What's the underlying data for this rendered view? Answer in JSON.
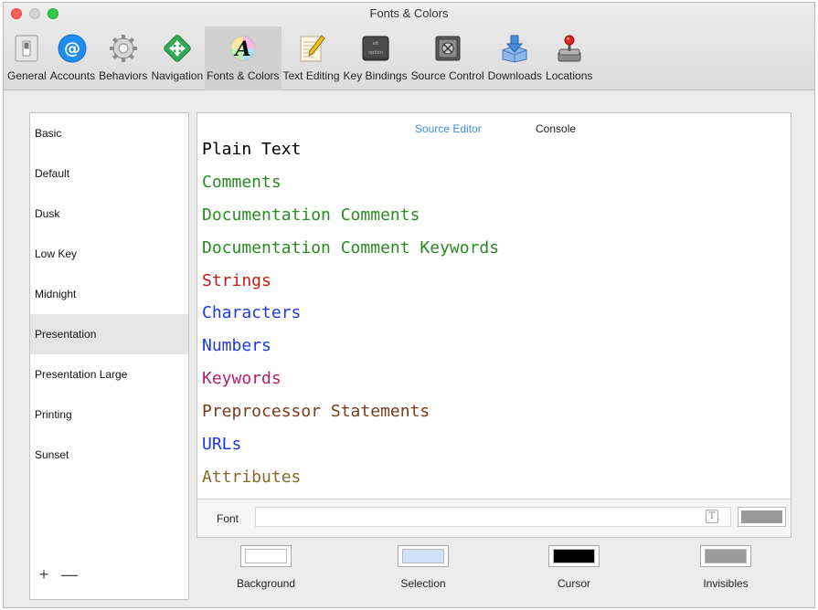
{
  "window": {
    "title": "Fonts & Colors"
  },
  "toolbar": {
    "items": [
      {
        "label": "General",
        "icon": "switch-icon"
      },
      {
        "label": "Accounts",
        "icon": "at-sign-icon"
      },
      {
        "label": "Behaviors",
        "icon": "gear-icon"
      },
      {
        "label": "Navigation",
        "icon": "navigation-arrows-icon"
      },
      {
        "label": "Fonts & Colors",
        "icon": "font-palette-icon",
        "selected": true
      },
      {
        "label": "Text Editing",
        "icon": "notepad-pencil-icon"
      },
      {
        "label": "Key Bindings",
        "icon": "option-key-icon",
        "key_text": "alt\noption"
      },
      {
        "label": "Source Control",
        "icon": "vault-icon"
      },
      {
        "label": "Downloads",
        "icon": "download-box-icon"
      },
      {
        "label": "Locations",
        "icon": "joystick-icon"
      }
    ]
  },
  "themes": {
    "items": [
      "Basic",
      "Default",
      "Dusk",
      "Low Key",
      "Midnight",
      "Presentation",
      "Presentation Large",
      "Printing",
      "Sunset"
    ],
    "selected": "Presentation",
    "add_label": "+",
    "remove_label": "—"
  },
  "editor": {
    "tabs": {
      "source_editor": "Source Editor",
      "console": "Console"
    },
    "active_tab": "Source Editor",
    "syntax_items": [
      {
        "label": "Plain Text",
        "color": "#000000"
      },
      {
        "label": "Comments",
        "color": "#2a8a22"
      },
      {
        "label": "Documentation Comments",
        "color": "#2a8a22"
      },
      {
        "label": "Documentation Comment Keywords",
        "color": "#2a8a22"
      },
      {
        "label": "Strings",
        "color": "#c41a16"
      },
      {
        "label": "Characters",
        "color": "#1c37e8"
      },
      {
        "label": "Numbers",
        "color": "#1c37e8"
      },
      {
        "label": "Keywords",
        "color": "#b4206d"
      },
      {
        "label": "Preprocessor Statements",
        "color": "#783c1d"
      },
      {
        "label": "URLs",
        "color": "#1c37e8"
      },
      {
        "label": "Attributes",
        "color": "#836c28"
      }
    ],
    "font": {
      "label": "Font",
      "value": "",
      "picker_glyph": "T",
      "color": "#999999"
    }
  },
  "wells": [
    {
      "label": "Background",
      "color": "#ffffff"
    },
    {
      "label": "Selection",
      "color": "#cfe1fb"
    },
    {
      "label": "Cursor",
      "color": "#000000"
    },
    {
      "label": "Invisibles",
      "color": "#9b9b9b"
    }
  ]
}
